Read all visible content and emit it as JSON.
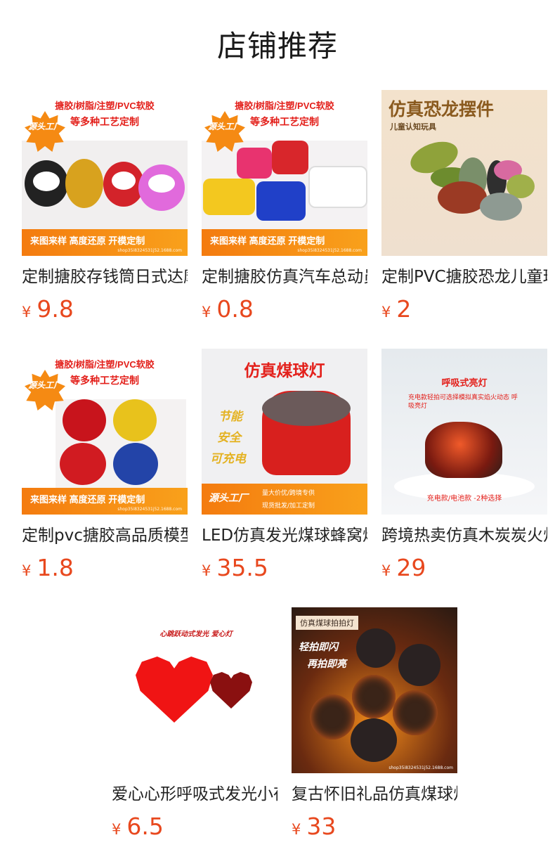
{
  "page_title": "店铺推荐",
  "currency": "¥",
  "image_text": {
    "craft_line1": "搪胶/树脂/注塑/PVC软胶",
    "craft_line2": "等多种工艺定制",
    "source_factory": "源头工厂",
    "bottom_bar": "来图来样 高度还原 开模定制",
    "shop_url": "shop35i8324531j52.1688.com",
    "dino_title": "仿真恐龙摆件",
    "dino_sub": "儿童认知玩具",
    "coal_title": "仿真煤球灯",
    "coal_features": [
      "节能",
      "安全",
      "可充电"
    ],
    "coal_factory": "源头工厂",
    "coal_bar1": "量大价优/跨境专供",
    "coal_bar2": "现货批发/加工定制",
    "charcoal_title": "呼吸式亮灯",
    "charcoal_desc": "充电款轻拍可选择模拟真实焰火动态 呼吸亮灯",
    "charcoal_option": "充电款/电池款 -2种选择",
    "heart_title": "心跳跃动式发光 爱心灯",
    "pat_title": "仿真煤球拍拍灯",
    "pat_line1": "轻拍即闪",
    "pat_line2": "再拍即亮"
  },
  "products": [
    {
      "name": "定制搪胶存钱筒日式达摩",
      "price": "9.8"
    },
    {
      "name": "定制搪胶仿真汽车总动员",
      "price": "0.8"
    },
    {
      "name": "定制PVC搪胶恐龙儿童玩具",
      "price": "2"
    },
    {
      "name": "定制pvc搪胶高品质模型",
      "price": "1.8"
    },
    {
      "name": "LED仿真发光煤球蜂窝煤灯",
      "price": "35.5"
    },
    {
      "name": "跨境热卖仿真木炭炭火灯",
      "price": "29"
    },
    {
      "name": "爱心心形呼吸式发光小夜灯",
      "price": "6.5"
    },
    {
      "name": "复古怀旧礼品仿真煤球灯",
      "price": "33"
    }
  ]
}
